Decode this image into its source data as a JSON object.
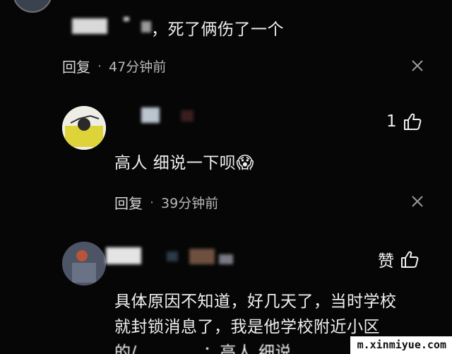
{
  "comments": [
    {
      "text": "，死了俩伤了一个",
      "reply_label": "回复",
      "separator": "·",
      "time": "47分钟前"
    },
    {
      "text": "高人 细说一下呗",
      "emoji": "😱",
      "reply_label": "回复",
      "separator": "·",
      "time": "39分钟前",
      "like_count": "1"
    },
    {
      "text_line1": "具体原因不知道，好几天了，当时学校",
      "text_line2": "就封锁消息了，我是他学校附近小区",
      "text_line3": "的/…………；高人 细说",
      "like_label": "赞"
    }
  ],
  "watermark": "m.xinmiyue.com",
  "icons": [
    "close-icon",
    "thumbs-up-icon",
    "avatar"
  ]
}
